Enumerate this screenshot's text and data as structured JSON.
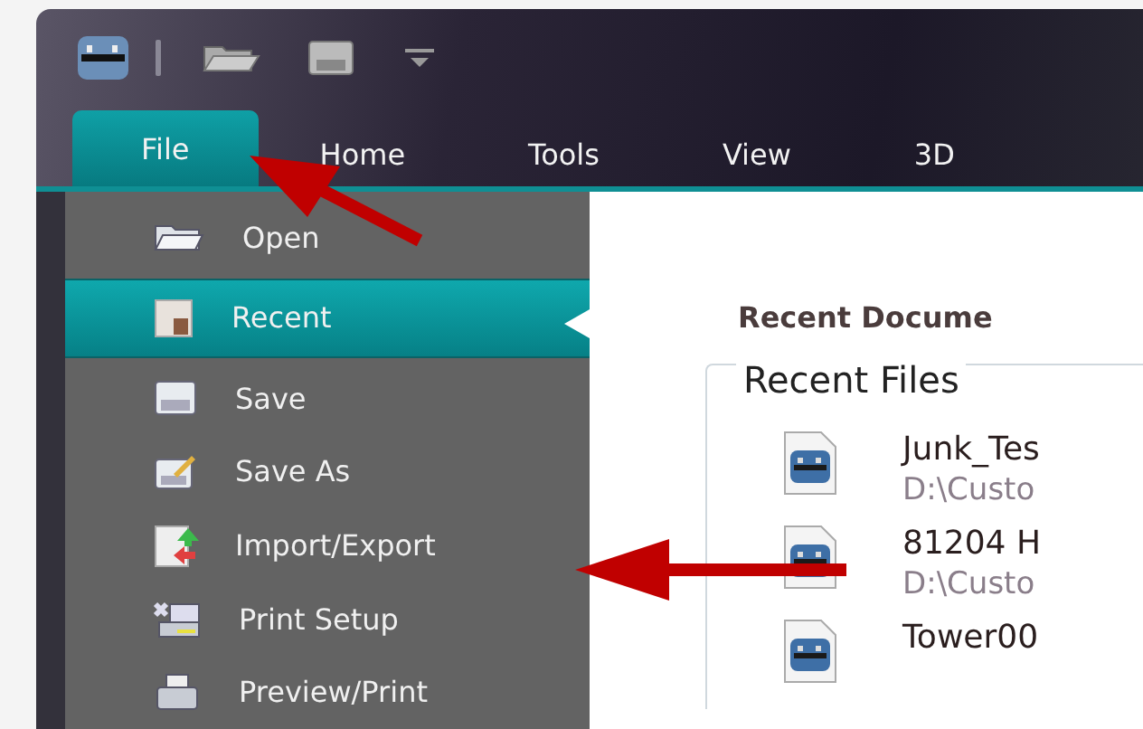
{
  "tabs": [
    {
      "label": "File",
      "selected": true
    },
    {
      "label": "Home",
      "selected": false
    },
    {
      "label": "Tools",
      "selected": false
    },
    {
      "label": "View",
      "selected": false
    },
    {
      "label": "3D",
      "selected": false
    }
  ],
  "file_menu": {
    "items": [
      {
        "label": "Open",
        "kind": "open",
        "selected": false
      },
      {
        "label": "Recent",
        "kind": "recent",
        "selected": true
      },
      {
        "label": "Save",
        "kind": "save",
        "selected": false
      },
      {
        "label": "Save As",
        "kind": "saveas",
        "selected": false
      },
      {
        "label": "Import/Export",
        "kind": "importexport",
        "selected": false
      },
      {
        "label": "Print Setup",
        "kind": "printsetup",
        "selected": false
      },
      {
        "label": "Preview/Print",
        "kind": "print",
        "selected": false
      }
    ]
  },
  "content": {
    "heading": "Recent Docume",
    "group_title": "Recent Files",
    "files": [
      {
        "name": "Junk_Tes",
        "path": "D:\\Custo"
      },
      {
        "name": "81204 H",
        "path": "D:\\Custo"
      },
      {
        "name": "Tower00"
      }
    ]
  }
}
